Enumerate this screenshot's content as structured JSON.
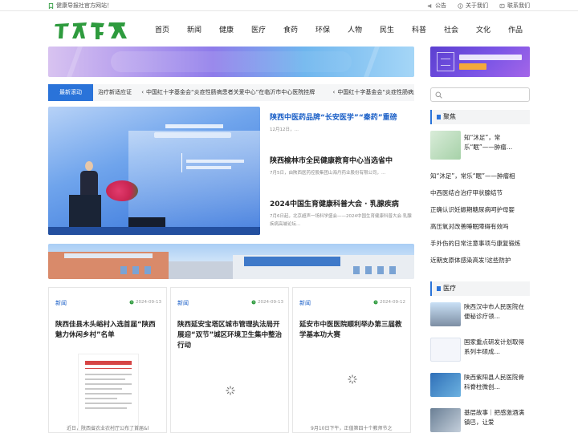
{
  "topbar": {
    "site_title": "健康导报社官方网站！",
    "links": [
      {
        "label": "公告",
        "icon": "speaker-icon"
      },
      {
        "label": "关于我们",
        "icon": "info-icon"
      },
      {
        "label": "联系我们",
        "icon": "contact-icon"
      }
    ]
  },
  "nav": [
    "首页",
    "新闻",
    "健康",
    "医疗",
    "食药",
    "环保",
    "人物",
    "民生",
    "科普",
    "社会",
    "文化",
    "作品"
  ],
  "ticker": {
    "label": "最新滚动",
    "items": [
      "治疗新适应证",
      "中国红十字基金会“炎症性肠病患者关爱中心”在临沂市中心医院挂牌",
      "中国红十字基金会“炎症性肠病患"
    ]
  },
  "feature_list": [
    {
      "title": "陕西中医药品牌“长安医学”“秦药”重磅",
      "desc": "12月12日，…"
    },
    {
      "title": "陕西榆林市全民健康教育中心当选省中",
      "desc": "7月5日，由陕西医药控股集团山海丹药业股份有限公司，…"
    },
    {
      "title": "2024中国生育健康科普大会 · 乳腺疾病",
      "desc": "7月6日起，北京超声一场科学盛会——2024中国生育健康科普大会·乳腺疾病高端论坛…"
    }
  ],
  "cards": [
    {
      "category": "新闻",
      "date": "2024-09-13",
      "title": "陕西佳县木头峪村入选首届“陕西魅力休闲乡村”名单",
      "snippet": "近日，陕西省农业农村厅公布了首届&l"
    },
    {
      "category": "新闻",
      "date": "2024-09-13",
      "title": "陕西延安宝塔区城市管理执法局开展迎“双节”城区环境卫生集中整治行动",
      "snippet": ""
    },
    {
      "category": "新闻",
      "date": "2024-09-12",
      "title": "延安市中医医院顺利举办第三届教学基本功大赛",
      "snippet": "9月10日下午，正值第四十个教师节之"
    }
  ],
  "sidebar": {
    "focus": {
      "heading": "聚焦",
      "thumb_item": "知“沐足”，常乐“眠”——肿瘤…",
      "items": [
        "知“沐足”，常乐“眠”——肿瘤相",
        "中西医结合治疗甲状腺结节",
        "正确认识妊娠期糖尿病呵护母婴",
        "高压氧对改善睡眠障碍有效吗",
        "手外伤的日常注意事项与康复锻炼",
        "近期支原体感染高发!这些防护"
      ]
    },
    "medical": {
      "heading": "医疗",
      "items": [
        "陕西汉中市人民医院在便秘诊疗领…",
        "国家重点研发计划取得系列丰硕成…",
        "陕西紫阳县人民医院骨科脊柱微创…",
        "基层故事｜把感激酒满镇巴，让爱"
      ]
    }
  },
  "colors": {
    "brand_blue": "#2a73d9",
    "logo_green": "#2e9b3e",
    "title_blue": "#1a5fc7"
  }
}
